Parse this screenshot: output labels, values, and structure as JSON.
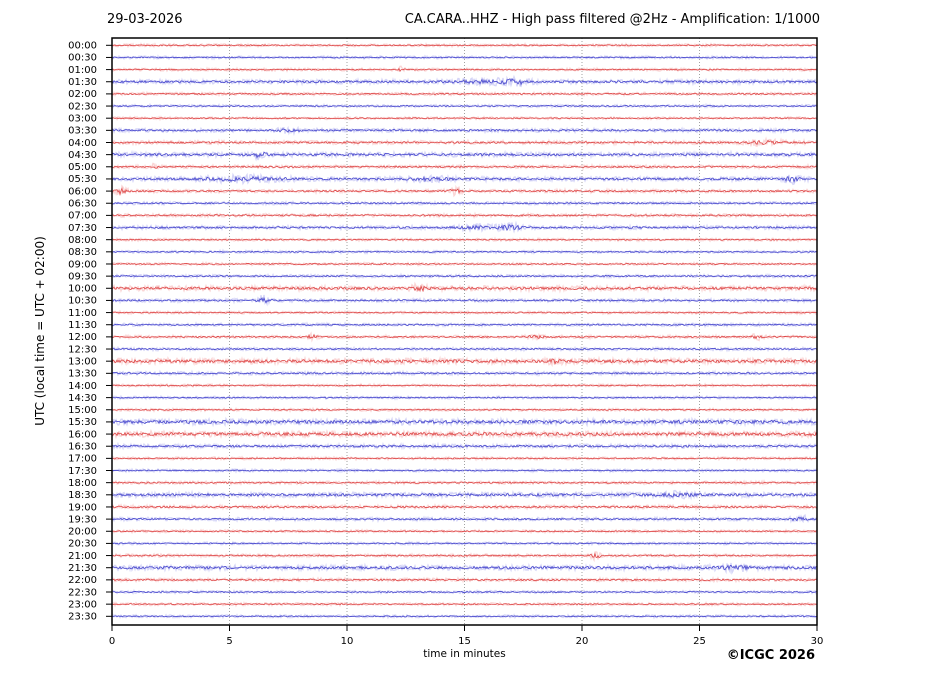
{
  "header": {
    "date": "29-03-2026",
    "title": "CA.CARA..HHZ - High pass filtered @2Hz - Amplification: 1/1000"
  },
  "footer": {
    "credit": "©ICGC 2026"
  },
  "colors": {
    "red_core": "#dd4444",
    "red_halo": "#f6b3b3",
    "blue_core": "#4444cc",
    "blue_halo": "#b3b3f0",
    "grid": "#999999",
    "frame": "#000000",
    "text": "#000000"
  },
  "chart_data": {
    "type": "line",
    "title": "CA.CARA..HHZ - High pass filtered @2Hz - Amplification: 1/1000",
    "xlabel": "time in minutes",
    "ylabel": "UTC (local time = UTC + 02:00)",
    "xlim": [
      0,
      30
    ],
    "x_ticks": [
      0,
      5,
      10,
      15,
      20,
      25,
      30
    ],
    "grid_minutes": [
      5,
      10,
      15,
      20,
      25
    ],
    "grid": true,
    "rows": [
      {
        "time": "00:00",
        "color": "red",
        "noise": 0.6,
        "events": []
      },
      {
        "time": "00:30",
        "color": "blue",
        "noise": 0.6,
        "events": []
      },
      {
        "time": "01:00",
        "color": "red",
        "noise": 0.6,
        "events": [
          [
            12.3,
            1.5,
            0.08
          ]
        ]
      },
      {
        "time": "01:30",
        "color": "blue",
        "noise": 1.1,
        "events": [
          [
            15.8,
            1.2,
            0.9
          ],
          [
            17.2,
            1.8,
            0.4
          ]
        ]
      },
      {
        "time": "02:00",
        "color": "red",
        "noise": 0.7,
        "events": []
      },
      {
        "time": "02:30",
        "color": "blue",
        "noise": 0.6,
        "events": []
      },
      {
        "time": "03:00",
        "color": "red",
        "noise": 0.55,
        "events": []
      },
      {
        "time": "03:30",
        "color": "blue",
        "noise": 0.9,
        "events": [
          [
            7.5,
            1.0,
            0.4
          ]
        ]
      },
      {
        "time": "04:00",
        "color": "red",
        "noise": 0.9,
        "events": [
          [
            27.8,
            1.3,
            0.5
          ]
        ]
      },
      {
        "time": "04:30",
        "color": "blue",
        "noise": 1.2,
        "events": [
          [
            6.3,
            2.6,
            0.15
          ]
        ]
      },
      {
        "time": "05:00",
        "color": "red",
        "noise": 0.8,
        "events": [
          [
            1.8,
            1.3,
            0.1
          ]
        ]
      },
      {
        "time": "05:30",
        "color": "blue",
        "noise": 1.1,
        "events": [
          [
            5.5,
            1.4,
            1.2
          ],
          [
            13.5,
            1.0,
            0.8
          ],
          [
            28.9,
            2.4,
            0.2
          ]
        ]
      },
      {
        "time": "06:00",
        "color": "red",
        "noise": 0.8,
        "events": [
          [
            0.4,
            2.8,
            0.15
          ],
          [
            14.6,
            1.8,
            0.2
          ]
        ]
      },
      {
        "time": "06:30",
        "color": "blue",
        "noise": 0.7,
        "events": []
      },
      {
        "time": "07:00",
        "color": "red",
        "noise": 0.8,
        "events": []
      },
      {
        "time": "07:30",
        "color": "blue",
        "noise": 0.9,
        "events": [
          [
            15.6,
            1.2,
            0.7
          ],
          [
            17.0,
            1.9,
            0.3
          ]
        ]
      },
      {
        "time": "08:00",
        "color": "red",
        "noise": 0.6,
        "events": []
      },
      {
        "time": "08:30",
        "color": "blue",
        "noise": 0.6,
        "events": []
      },
      {
        "time": "09:00",
        "color": "red",
        "noise": 0.6,
        "events": []
      },
      {
        "time": "09:30",
        "color": "blue",
        "noise": 0.7,
        "events": []
      },
      {
        "time": "10:00",
        "color": "red",
        "noise": 1.3,
        "events": [
          [
            13.0,
            1.8,
            0.25
          ]
        ]
      },
      {
        "time": "10:30",
        "color": "blue",
        "noise": 0.8,
        "events": [
          [
            6.4,
            2.6,
            0.15
          ]
        ]
      },
      {
        "time": "11:00",
        "color": "red",
        "noise": 0.6,
        "events": []
      },
      {
        "time": "11:30",
        "color": "blue",
        "noise": 0.7,
        "events": []
      },
      {
        "time": "12:00",
        "color": "red",
        "noise": 0.7,
        "events": [
          [
            8.5,
            1.8,
            0.15
          ],
          [
            18.0,
            1.0,
            0.3
          ],
          [
            27.4,
            1.4,
            0.2
          ]
        ]
      },
      {
        "time": "12:30",
        "color": "blue",
        "noise": 0.7,
        "events": []
      },
      {
        "time": "13:00",
        "color": "red",
        "noise": 1.5,
        "events": [
          [
            18.9,
            1.3,
            0.2
          ]
        ]
      },
      {
        "time": "13:30",
        "color": "blue",
        "noise": 0.8,
        "events": []
      },
      {
        "time": "14:00",
        "color": "red",
        "noise": 0.6,
        "events": []
      },
      {
        "time": "14:30",
        "color": "blue",
        "noise": 0.6,
        "events": []
      },
      {
        "time": "15:00",
        "color": "red",
        "noise": 0.6,
        "events": []
      },
      {
        "time": "15:30",
        "color": "blue",
        "noise": 1.6,
        "events": []
      },
      {
        "time": "16:00",
        "color": "red",
        "noise": 1.6,
        "events": []
      },
      {
        "time": "16:30",
        "color": "blue",
        "noise": 1.0,
        "events": []
      },
      {
        "time": "17:00",
        "color": "red",
        "noise": 0.6,
        "events": []
      },
      {
        "time": "17:30",
        "color": "blue",
        "noise": 0.6,
        "events": []
      },
      {
        "time": "18:00",
        "color": "red",
        "noise": 0.7,
        "events": []
      },
      {
        "time": "18:30",
        "color": "blue",
        "noise": 1.3,
        "events": [
          [
            24.0,
            1.2,
            0.4
          ]
        ]
      },
      {
        "time": "19:00",
        "color": "red",
        "noise": 0.9,
        "events": []
      },
      {
        "time": "19:30",
        "color": "blue",
        "noise": 0.8,
        "events": [
          [
            29.3,
            1.8,
            0.25
          ]
        ]
      },
      {
        "time": "20:00",
        "color": "red",
        "noise": 0.6,
        "events": []
      },
      {
        "time": "20:30",
        "color": "blue",
        "noise": 0.6,
        "events": []
      },
      {
        "time": "21:00",
        "color": "red",
        "noise": 0.7,
        "events": [
          [
            20.6,
            2.0,
            0.15
          ]
        ]
      },
      {
        "time": "21:30",
        "color": "blue",
        "noise": 1.3,
        "events": [
          [
            26.5,
            1.5,
            0.4
          ]
        ]
      },
      {
        "time": "22:00",
        "color": "red",
        "noise": 0.8,
        "events": []
      },
      {
        "time": "22:30",
        "color": "blue",
        "noise": 0.6,
        "events": []
      },
      {
        "time": "23:00",
        "color": "red",
        "noise": 0.6,
        "events": []
      },
      {
        "time": "23:30",
        "color": "blue",
        "noise": 0.6,
        "events": []
      }
    ]
  }
}
